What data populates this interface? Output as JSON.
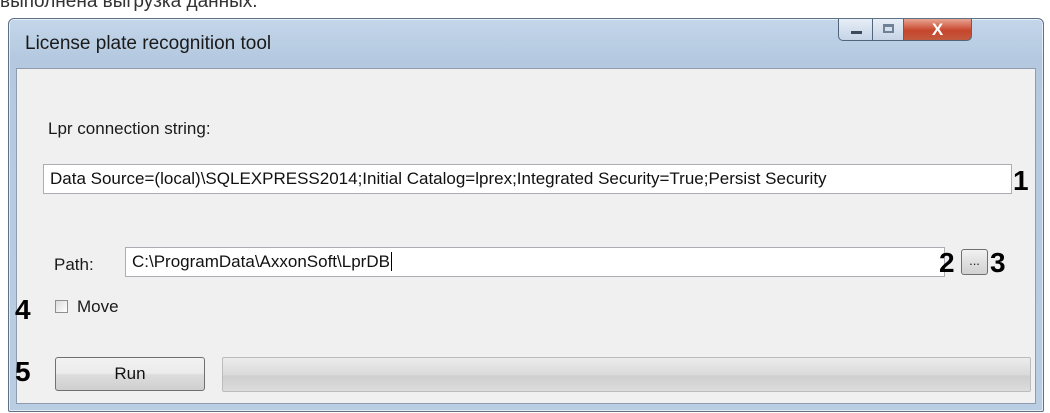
{
  "caption_above": "выполнена выгрузка данных.",
  "window": {
    "title": "License plate recognition tool",
    "close_glyph": "X"
  },
  "form": {
    "connection_label": "Lpr connection string:",
    "connection_value": "Data Source=(local)\\SQLEXPRESS2014;Initial Catalog=lprex;Integrated Security=True;Persist Security",
    "path_label": "Path:",
    "path_value": "C:\\ProgramData\\AxxonSoft\\LprDB",
    "browse_label": "...",
    "move_label": "Move",
    "move_checked": false,
    "run_label": "Run",
    "progress": 0
  },
  "annotations": {
    "n1": "1",
    "n2": "2",
    "n3": "3",
    "n4": "4",
    "n5": "5"
  },
  "colors": {
    "progress_fill": "#06b025",
    "close_button": "#c7462c"
  }
}
